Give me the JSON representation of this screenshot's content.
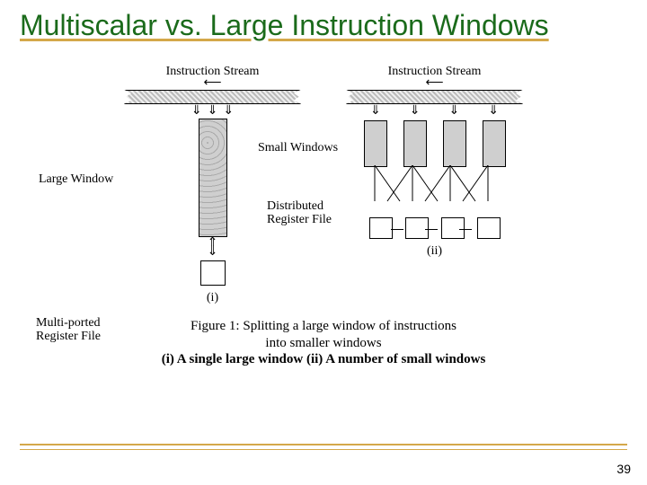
{
  "title": "Multiscalar vs. Large Instruction Windows",
  "figure": {
    "stream_label": "Instruction Stream",
    "panel_i": {
      "side_top": "Large  Window",
      "side_bottom": "Multi-ported\nRegister File",
      "sub": "(i)"
    },
    "panel_ii": {
      "side_top": "Small Windows",
      "side_bottom": "Distributed\nRegister File",
      "sub": "(ii)"
    },
    "caption_line1": "Figure 1:  Splitting a large window of instructions",
    "caption_line2": "into smaller windows",
    "caption_line3": "(i) A single large window   (ii) A number of small windows"
  },
  "page_number": "39"
}
